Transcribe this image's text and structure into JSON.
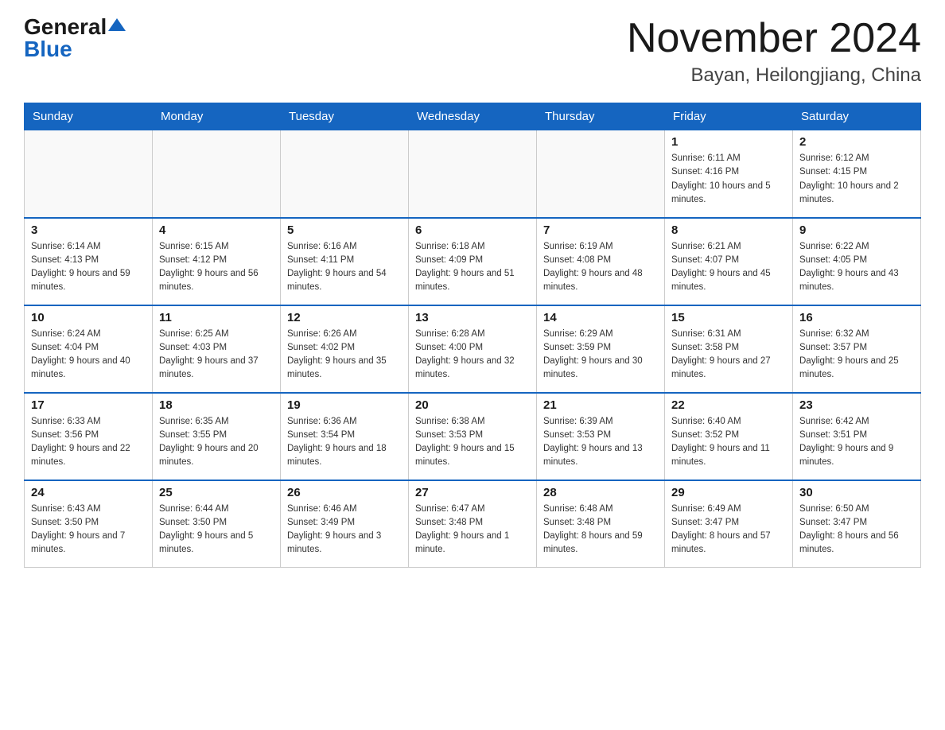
{
  "header": {
    "logo_general": "General",
    "logo_blue": "Blue",
    "month_title": "November 2024",
    "location": "Bayan, Heilongjiang, China"
  },
  "weekdays": [
    "Sunday",
    "Monday",
    "Tuesday",
    "Wednesday",
    "Thursday",
    "Friday",
    "Saturday"
  ],
  "weeks": [
    [
      {
        "day": "",
        "sunrise": "",
        "sunset": "",
        "daylight": ""
      },
      {
        "day": "",
        "sunrise": "",
        "sunset": "",
        "daylight": ""
      },
      {
        "day": "",
        "sunrise": "",
        "sunset": "",
        "daylight": ""
      },
      {
        "day": "",
        "sunrise": "",
        "sunset": "",
        "daylight": ""
      },
      {
        "day": "",
        "sunrise": "",
        "sunset": "",
        "daylight": ""
      },
      {
        "day": "1",
        "sunrise": "Sunrise: 6:11 AM",
        "sunset": "Sunset: 4:16 PM",
        "daylight": "Daylight: 10 hours and 5 minutes."
      },
      {
        "day": "2",
        "sunrise": "Sunrise: 6:12 AM",
        "sunset": "Sunset: 4:15 PM",
        "daylight": "Daylight: 10 hours and 2 minutes."
      }
    ],
    [
      {
        "day": "3",
        "sunrise": "Sunrise: 6:14 AM",
        "sunset": "Sunset: 4:13 PM",
        "daylight": "Daylight: 9 hours and 59 minutes."
      },
      {
        "day": "4",
        "sunrise": "Sunrise: 6:15 AM",
        "sunset": "Sunset: 4:12 PM",
        "daylight": "Daylight: 9 hours and 56 minutes."
      },
      {
        "day": "5",
        "sunrise": "Sunrise: 6:16 AM",
        "sunset": "Sunset: 4:11 PM",
        "daylight": "Daylight: 9 hours and 54 minutes."
      },
      {
        "day": "6",
        "sunrise": "Sunrise: 6:18 AM",
        "sunset": "Sunset: 4:09 PM",
        "daylight": "Daylight: 9 hours and 51 minutes."
      },
      {
        "day": "7",
        "sunrise": "Sunrise: 6:19 AM",
        "sunset": "Sunset: 4:08 PM",
        "daylight": "Daylight: 9 hours and 48 minutes."
      },
      {
        "day": "8",
        "sunrise": "Sunrise: 6:21 AM",
        "sunset": "Sunset: 4:07 PM",
        "daylight": "Daylight: 9 hours and 45 minutes."
      },
      {
        "day": "9",
        "sunrise": "Sunrise: 6:22 AM",
        "sunset": "Sunset: 4:05 PM",
        "daylight": "Daylight: 9 hours and 43 minutes."
      }
    ],
    [
      {
        "day": "10",
        "sunrise": "Sunrise: 6:24 AM",
        "sunset": "Sunset: 4:04 PM",
        "daylight": "Daylight: 9 hours and 40 minutes."
      },
      {
        "day": "11",
        "sunrise": "Sunrise: 6:25 AM",
        "sunset": "Sunset: 4:03 PM",
        "daylight": "Daylight: 9 hours and 37 minutes."
      },
      {
        "day": "12",
        "sunrise": "Sunrise: 6:26 AM",
        "sunset": "Sunset: 4:02 PM",
        "daylight": "Daylight: 9 hours and 35 minutes."
      },
      {
        "day": "13",
        "sunrise": "Sunrise: 6:28 AM",
        "sunset": "Sunset: 4:00 PM",
        "daylight": "Daylight: 9 hours and 32 minutes."
      },
      {
        "day": "14",
        "sunrise": "Sunrise: 6:29 AM",
        "sunset": "Sunset: 3:59 PM",
        "daylight": "Daylight: 9 hours and 30 minutes."
      },
      {
        "day": "15",
        "sunrise": "Sunrise: 6:31 AM",
        "sunset": "Sunset: 3:58 PM",
        "daylight": "Daylight: 9 hours and 27 minutes."
      },
      {
        "day": "16",
        "sunrise": "Sunrise: 6:32 AM",
        "sunset": "Sunset: 3:57 PM",
        "daylight": "Daylight: 9 hours and 25 minutes."
      }
    ],
    [
      {
        "day": "17",
        "sunrise": "Sunrise: 6:33 AM",
        "sunset": "Sunset: 3:56 PM",
        "daylight": "Daylight: 9 hours and 22 minutes."
      },
      {
        "day": "18",
        "sunrise": "Sunrise: 6:35 AM",
        "sunset": "Sunset: 3:55 PM",
        "daylight": "Daylight: 9 hours and 20 minutes."
      },
      {
        "day": "19",
        "sunrise": "Sunrise: 6:36 AM",
        "sunset": "Sunset: 3:54 PM",
        "daylight": "Daylight: 9 hours and 18 minutes."
      },
      {
        "day": "20",
        "sunrise": "Sunrise: 6:38 AM",
        "sunset": "Sunset: 3:53 PM",
        "daylight": "Daylight: 9 hours and 15 minutes."
      },
      {
        "day": "21",
        "sunrise": "Sunrise: 6:39 AM",
        "sunset": "Sunset: 3:53 PM",
        "daylight": "Daylight: 9 hours and 13 minutes."
      },
      {
        "day": "22",
        "sunrise": "Sunrise: 6:40 AM",
        "sunset": "Sunset: 3:52 PM",
        "daylight": "Daylight: 9 hours and 11 minutes."
      },
      {
        "day": "23",
        "sunrise": "Sunrise: 6:42 AM",
        "sunset": "Sunset: 3:51 PM",
        "daylight": "Daylight: 9 hours and 9 minutes."
      }
    ],
    [
      {
        "day": "24",
        "sunrise": "Sunrise: 6:43 AM",
        "sunset": "Sunset: 3:50 PM",
        "daylight": "Daylight: 9 hours and 7 minutes."
      },
      {
        "day": "25",
        "sunrise": "Sunrise: 6:44 AM",
        "sunset": "Sunset: 3:50 PM",
        "daylight": "Daylight: 9 hours and 5 minutes."
      },
      {
        "day": "26",
        "sunrise": "Sunrise: 6:46 AM",
        "sunset": "Sunset: 3:49 PM",
        "daylight": "Daylight: 9 hours and 3 minutes."
      },
      {
        "day": "27",
        "sunrise": "Sunrise: 6:47 AM",
        "sunset": "Sunset: 3:48 PM",
        "daylight": "Daylight: 9 hours and 1 minute."
      },
      {
        "day": "28",
        "sunrise": "Sunrise: 6:48 AM",
        "sunset": "Sunset: 3:48 PM",
        "daylight": "Daylight: 8 hours and 59 minutes."
      },
      {
        "day": "29",
        "sunrise": "Sunrise: 6:49 AM",
        "sunset": "Sunset: 3:47 PM",
        "daylight": "Daylight: 8 hours and 57 minutes."
      },
      {
        "day": "30",
        "sunrise": "Sunrise: 6:50 AM",
        "sunset": "Sunset: 3:47 PM",
        "daylight": "Daylight: 8 hours and 56 minutes."
      }
    ]
  ]
}
